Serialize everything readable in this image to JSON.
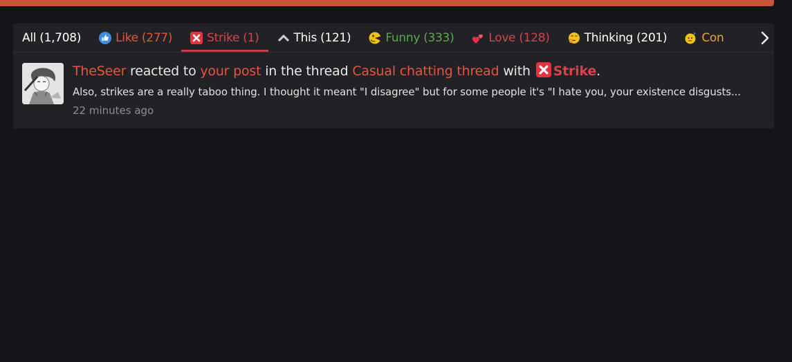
{
  "tabs": [
    {
      "label": "All (1,708)",
      "color": "#ffffff",
      "icon": null,
      "active": false
    },
    {
      "label": "Like (277)",
      "color": "#e8553a",
      "icon": "thumbs-up-icon",
      "active": false
    },
    {
      "label": "Strike (1)",
      "color": "#d9424d",
      "icon": "strike-icon",
      "active": true
    },
    {
      "label": "This (121)",
      "color": "#ffffff",
      "icon": "chevron-up-icon",
      "active": false
    },
    {
      "label": "Funny (333)",
      "color": "#5aa84f",
      "icon": "funny-face-icon",
      "active": false
    },
    {
      "label": "Love (128)",
      "color": "#d9424d",
      "icon": "hearts-icon",
      "active": false
    },
    {
      "label": "Thinking (201)",
      "color": "#ffffff",
      "icon": "thinking-face-icon",
      "active": false
    },
    {
      "label": "Con",
      "color": "#e8a23a",
      "icon": "confused-face-icon",
      "active": false
    }
  ],
  "notification": {
    "user": "TheSeer",
    "text_reacted": " reacted to ",
    "post_link": "your post",
    "text_thread": " in the thread ",
    "thread_link": "Casual chatting thread",
    "text_with": " with ",
    "reaction": "Strike",
    "period": ".",
    "snippet": "Also, strikes are a really taboo thing. I thought it meant \"I disagree\" but for some people it's \"I hate you, your existence disgusts...",
    "time": "22 minutes ago"
  },
  "colors": {
    "accent": "#e8553a",
    "strike": "#d9424d",
    "background": "#151519",
    "panel": "#222226"
  }
}
